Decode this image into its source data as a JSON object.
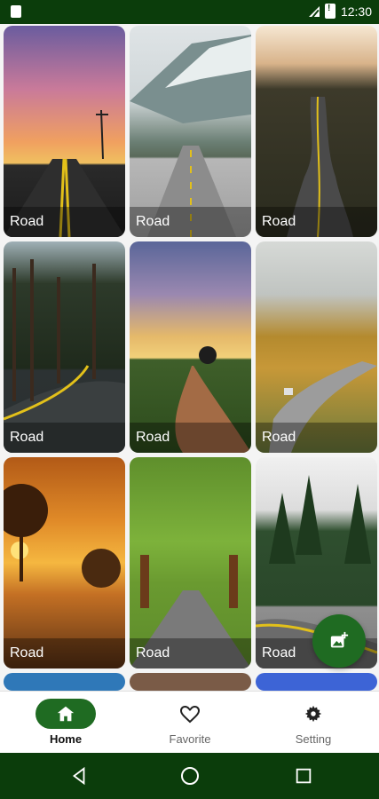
{
  "status_bar": {
    "time": "12:30"
  },
  "cards": [
    {
      "label": "Road"
    },
    {
      "label": "Road"
    },
    {
      "label": "Road"
    },
    {
      "label": "Road"
    },
    {
      "label": "Road"
    },
    {
      "label": "Road"
    },
    {
      "label": "Road"
    },
    {
      "label": "Road"
    },
    {
      "label": "Road"
    }
  ],
  "bottom_nav": {
    "items": [
      {
        "label": "Home",
        "icon": "home-icon",
        "active": true
      },
      {
        "label": "Favorite",
        "icon": "heart-icon",
        "active": false
      },
      {
        "label": "Setting",
        "icon": "gear-icon",
        "active": false
      }
    ]
  },
  "fab": {
    "icon": "add-photo-icon"
  },
  "colors": {
    "status_bar": "#0b3d0b",
    "accent": "#1f6b22"
  }
}
